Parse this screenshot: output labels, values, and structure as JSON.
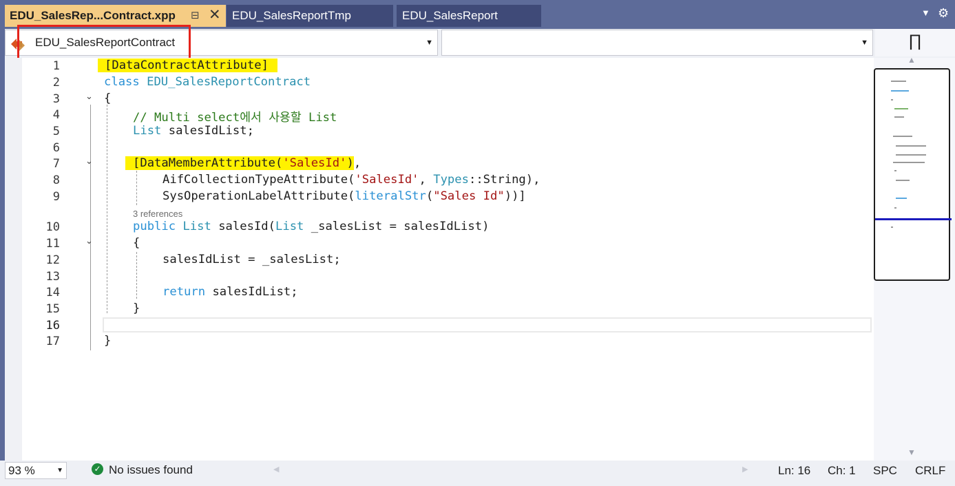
{
  "tabs": [
    {
      "label": "EDU_SalesRep...Contract.xpp",
      "active": true,
      "pin_icon": "pin-icon",
      "close_icon": "close-icon"
    },
    {
      "label": "EDU_SalesReportTmp",
      "active": false
    },
    {
      "label": "EDU_SalesReport",
      "active": false
    }
  ],
  "navbar": {
    "class_combo_value": "EDU_SalesReportContract",
    "member_combo_value": "",
    "class_icon": "class-icon",
    "split_icon": "split-window-icon"
  },
  "editor": {
    "references_label": "3 references",
    "lines": [
      {
        "n": "1",
        "code": "[DataContractAttribute]"
      },
      {
        "n": "2",
        "code": "class EDU_SalesReportContract"
      },
      {
        "n": "3",
        "code": "{"
      },
      {
        "n": "4",
        "code": "// Multi select에서 사용할 List"
      },
      {
        "n": "5",
        "code": "List salesIdList;"
      },
      {
        "n": "6",
        "code": ""
      },
      {
        "n": "7",
        "code": "[DataMemberAttribute('SalesId'),"
      },
      {
        "n": "8",
        "code": "AifCollectionTypeAttribute('SalesId', Types::String),"
      },
      {
        "n": "9",
        "code": "SysOperationLabelAttribute(literalStr(\"Sales Id\"))]"
      },
      {
        "n": "10",
        "code": "public List salesId(List _salesList = salesIdList)"
      },
      {
        "n": "11",
        "code": "{"
      },
      {
        "n": "12",
        "code": "salesIdList = _salesList;"
      },
      {
        "n": "13",
        "code": ""
      },
      {
        "n": "14",
        "code": "return salesIdList;"
      },
      {
        "n": "15",
        "code": "}"
      },
      {
        "n": "16",
        "code": ""
      },
      {
        "n": "17",
        "code": "}"
      }
    ]
  },
  "statusbar": {
    "zoom": "93 %",
    "issues": "No issues found",
    "line": "Ln: 16",
    "column": "Ch: 1",
    "indent": "SPC",
    "line_ending": "CRLF"
  },
  "colors": {
    "tab_active_bg": "#f5cc84",
    "tab_inactive_bg": "#3f4a78",
    "chrome_bg": "#5d6b99",
    "keyword": "#2b91d5",
    "type": "#2b91af",
    "string": "#a31515",
    "comment": "#2c7a1b",
    "attribute_highlight": "#fff200",
    "callout_border": "#e5231b"
  }
}
